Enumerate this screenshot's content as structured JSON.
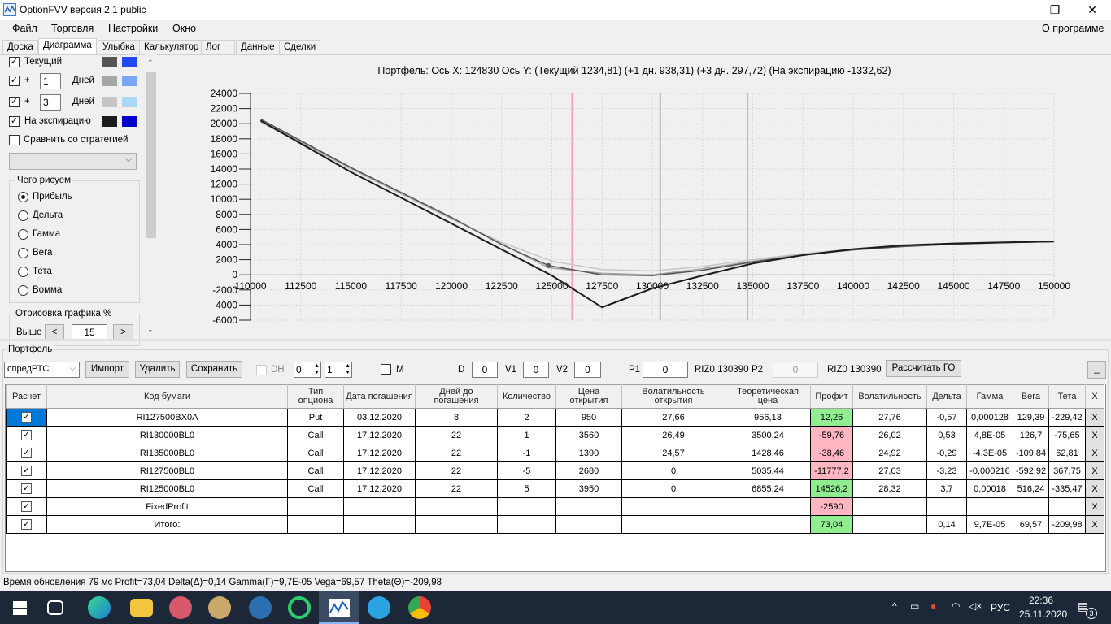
{
  "window": {
    "title": "OptionFVV версия 2.1 public",
    "minimize": "—",
    "maximize": "❐",
    "close": "✕"
  },
  "menu": {
    "items": [
      "Файл",
      "Торговля",
      "Настройки",
      "Окно"
    ],
    "about": "О программе"
  },
  "tabs": [
    "Доска",
    "Диаграмма",
    "Улыбка",
    "Калькулятор",
    "Лог",
    "Данные",
    "Сделки"
  ],
  "left_panel": {
    "current": {
      "label": "Текущий",
      "checked": true,
      "colors": [
        "#555555",
        "#2447f5"
      ]
    },
    "plus1": {
      "plus": "+",
      "value": "1",
      "unit": "Дней",
      "checked": true,
      "colors": [
        "#a6a6a6",
        "#79a6f7"
      ]
    },
    "plus3": {
      "plus": "+",
      "value": "3",
      "unit": "Дней",
      "checked": true,
      "colors": [
        "#c6c6c6",
        "#a9d8fb"
      ]
    },
    "expiration": {
      "label": "На экспирацию",
      "checked": true,
      "colors": [
        "#1c1c1c",
        "#0000c8"
      ]
    },
    "compare": {
      "label": "Сравнить со стратегией",
      "checked": false
    },
    "strategy_select": "",
    "draw_group": {
      "title": "Чего рисуем",
      "options": [
        "Прибыль",
        "Дельта",
        "Гамма",
        "Вега",
        "Тета",
        "Вомма"
      ],
      "selected": "Прибыль"
    },
    "render_group": {
      "title": "Отрисовка графика %",
      "above_label": "Выше",
      "prev": "<",
      "next": ">",
      "value": "15"
    }
  },
  "chart_header": "Портфель: Ось X: 124830 Ось Y:  (Текущий 1234,81)  (+1 дн. 938,31)  (+3 дн. 297,72)  (На экспирацию -1332,62)",
  "chart_data": {
    "type": "line",
    "xlim": [
      110000,
      150000
    ],
    "ylim": [
      -6000,
      24000
    ],
    "xticks": [
      110000,
      112500,
      115000,
      117500,
      120000,
      122500,
      125000,
      127500,
      130000,
      132500,
      135000,
      137500,
      140000,
      142500,
      145000,
      147500,
      150000
    ],
    "yticks": [
      -6000,
      -4000,
      -2000,
      0,
      2000,
      4000,
      6000,
      8000,
      10000,
      12000,
      14000,
      16000,
      18000,
      20000,
      22000,
      24000
    ],
    "grid": true,
    "vlines": [
      {
        "x": 126000,
        "color": "#ff9aa8"
      },
      {
        "x": 130390,
        "color": "#7080a0"
      },
      {
        "x": 134750,
        "color": "#ff9aa8"
      }
    ],
    "marker": {
      "x": 124830,
      "y": 1234.81
    },
    "series": [
      {
        "name": "+3 дн.",
        "color": "#c6c6c6",
        "points": [
          [
            110500,
            20200
          ],
          [
            115000,
            14000
          ],
          [
            120000,
            7400
          ],
          [
            122500,
            4300
          ],
          [
            125000,
            1800
          ],
          [
            127500,
            700
          ],
          [
            130000,
            500
          ],
          [
            132500,
            1100
          ],
          [
            135000,
            2000
          ],
          [
            137500,
            2800
          ],
          [
            140000,
            3400
          ],
          [
            142500,
            3800
          ],
          [
            145000,
            4050
          ],
          [
            147500,
            4250
          ],
          [
            150000,
            4400
          ]
        ]
      },
      {
        "name": "+1 дн.",
        "color": "#a6a6a6",
        "points": [
          [
            110500,
            20400
          ],
          [
            115000,
            14100
          ],
          [
            120000,
            7500
          ],
          [
            122500,
            4100
          ],
          [
            124830,
            938
          ],
          [
            127500,
            200
          ],
          [
            130000,
            0
          ],
          [
            132500,
            800
          ],
          [
            135000,
            1800
          ],
          [
            137500,
            2700
          ],
          [
            140000,
            3300
          ],
          [
            142500,
            3750
          ],
          [
            145000,
            4050
          ],
          [
            147500,
            4250
          ],
          [
            150000,
            4400
          ]
        ]
      },
      {
        "name": "Текущий",
        "color": "#555555",
        "points": [
          [
            110500,
            20600
          ],
          [
            115000,
            14200
          ],
          [
            120000,
            7600
          ],
          [
            122500,
            4000
          ],
          [
            124830,
            1234
          ],
          [
            127500,
            0
          ],
          [
            130000,
            -100
          ],
          [
            132500,
            600
          ],
          [
            135000,
            1700
          ],
          [
            137500,
            2600
          ],
          [
            140000,
            3300
          ],
          [
            142500,
            3750
          ],
          [
            145000,
            4050
          ],
          [
            147500,
            4250
          ],
          [
            150000,
            4400
          ]
        ]
      },
      {
        "name": "На экспирацию",
        "color": "#1c1c1c",
        "points": [
          [
            110500,
            20400
          ],
          [
            115000,
            13600
          ],
          [
            120000,
            6800
          ],
          [
            125000,
            -100
          ],
          [
            127500,
            -4300
          ],
          [
            130000,
            -1800
          ],
          [
            132500,
            -100
          ],
          [
            135000,
            1500
          ],
          [
            137500,
            2600
          ],
          [
            140000,
            3400
          ],
          [
            142500,
            3900
          ],
          [
            145000,
            4150
          ],
          [
            147500,
            4300
          ],
          [
            150000,
            4400
          ]
        ]
      }
    ]
  },
  "portfolio": {
    "title": "Портфель",
    "select": "спредРТС",
    "import": "Импорт",
    "delete": "Удалить",
    "save": "Сохранить",
    "dh": "DH",
    "spin1": "0",
    "spin2": "1",
    "m": "M",
    "d_label": "D",
    "d": "0",
    "v1_label": "V1",
    "v1": "0",
    "v2_label": "V2",
    "v2": "0",
    "p1_label": "P1",
    "p1": "0",
    "p1_info": "RIZ0 130390",
    "p2_label": "P2",
    "p2": "0",
    "p2_info": "RIZ0 130390",
    "calc_go": "Рассчитать ГО",
    "minimize": "_",
    "columns": [
      "Расчет",
      "Код бумаги",
      "Тип опциона",
      "Дата погашения",
      "Дней до погашения",
      "Количество",
      "Цена открытия",
      "Волатильность открытия",
      "Теоретическая цена",
      "Профит",
      "Волатильность",
      "Дельта",
      "Гамма",
      "Вега",
      "Тета",
      "X"
    ],
    "rows": [
      [
        "RI127500BX0A",
        "Put",
        "03.12.2020",
        "8",
        "2",
        "950",
        "27,66",
        "956,13",
        "12,26",
        "27,76",
        "-0,57",
        "0,000128",
        "129,39",
        "-229,42"
      ],
      [
        "RI130000BL0",
        "Call",
        "17.12.2020",
        "22",
        "1",
        "3560",
        "26,49",
        "3500,24",
        "-59,76",
        "26,02",
        "0,53",
        "4,8E-05",
        "126,7",
        "-75,65"
      ],
      [
        "RI135000BL0",
        "Call",
        "17.12.2020",
        "22",
        "-1",
        "1390",
        "24,57",
        "1428,46",
        "-38,46",
        "24,92",
        "-0,29",
        "-4,3E-05",
        "-109,84",
        "62,81"
      ],
      [
        "RI127500BL0",
        "Call",
        "17.12.2020",
        "22",
        "-5",
        "2680",
        "0",
        "5035,44",
        "-11777,2",
        "27,03",
        "-3,23",
        "-0,000216",
        "-592,92",
        "367,75"
      ],
      [
        "RI125000BL0",
        "Call",
        "17.12.2020",
        "22",
        "5",
        "3950",
        "0",
        "6855,24",
        "14526,2",
        "28,32",
        "3,7",
        "0,00018",
        "516,24",
        "-335,47"
      ],
      [
        "FixedProfit",
        "",
        "",
        "",
        "",
        "",
        "",
        "",
        "-2590",
        "",
        "",
        "",
        "",
        ""
      ],
      [
        "Итого:",
        "",
        "",
        "",
        "",
        "",
        "",
        "",
        "73,04",
        "",
        "0,14",
        "9,7E-05",
        "69,57",
        "-209,98"
      ]
    ],
    "delete_x": "X"
  },
  "status": "Время обновления 79 мс  Profit=73,04 Delta(Δ)=0,14 Gamma(Γ)=9,7E-05 Vega=69,57 Theta(Θ)=-209,98",
  "taskbar": {
    "lang": "РУС",
    "time": "22:36",
    "date": "25.11.2020",
    "notifications": "3"
  }
}
